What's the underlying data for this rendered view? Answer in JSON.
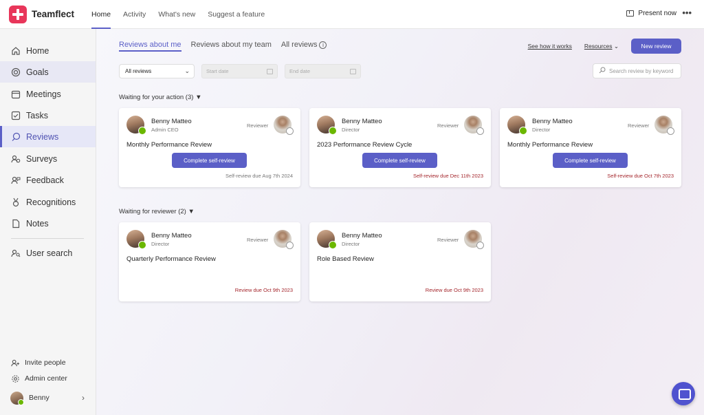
{
  "app": {
    "name": "Teamflect"
  },
  "topnav": {
    "items": [
      "Home",
      "Activity",
      "What's new",
      "Suggest a feature"
    ],
    "active": "Home"
  },
  "top_actions": {
    "present_label": "Present now",
    "more_label": "•••"
  },
  "sidebar": {
    "items": [
      {
        "label": "Home",
        "icon": "home-icon"
      },
      {
        "label": "Goals",
        "icon": "target-icon"
      },
      {
        "label": "Meetings",
        "icon": "calendar-icon"
      },
      {
        "label": "Tasks",
        "icon": "checkbox-icon"
      },
      {
        "label": "Reviews",
        "icon": "review-icon"
      },
      {
        "label": "Surveys",
        "icon": "survey-icon"
      },
      {
        "label": "Feedback",
        "icon": "feedback-icon"
      },
      {
        "label": "Recognitions",
        "icon": "medal-icon"
      },
      {
        "label": "Notes",
        "icon": "note-icon"
      },
      {
        "label": "User search",
        "icon": "user-search-icon"
      }
    ],
    "active": "Reviews",
    "bottom": {
      "invite": "Invite people",
      "admin": "Admin center",
      "user": "Benny"
    }
  },
  "tabs": [
    "Reviews about me",
    "Reviews about my team",
    "All reviews"
  ],
  "active_tab": "Reviews about me",
  "header_links": {
    "how": "See how it works",
    "resources": "Resources",
    "new_review": "New review"
  },
  "filters": {
    "select_value": "All reviews",
    "start_placeholder": "Start date",
    "end_placeholder": "End date",
    "search_placeholder": "Search review by keyword"
  },
  "sections": [
    {
      "title": "Waiting for your action (3)",
      "cards": [
        {
          "name": "Benny Matteo",
          "role": "Admin CEO",
          "reviewer_label": "Reviewer",
          "title": "Monthly Performance Review",
          "button": "Complete self-review",
          "due": "Self-review due Aug 7th 2024",
          "overdue": false
        },
        {
          "name": "Benny Matteo",
          "role": "Director",
          "reviewer_label": "Reviewer",
          "title": "2023 Performance Review Cycle",
          "button": "Complete self-review",
          "due": "Self-review due Dec 11th 2023",
          "overdue": true
        },
        {
          "name": "Benny Matteo",
          "role": "Director",
          "reviewer_label": "Reviewer",
          "title": "Monthly Performance Review",
          "button": "Complete self-review",
          "due": "Self-review due Oct 7th 2023",
          "overdue": true
        }
      ]
    },
    {
      "title": "Waiting for reviewer (2)",
      "cards": [
        {
          "name": "Benny Matteo",
          "role": "Director",
          "reviewer_label": "Reviewer",
          "title": "Quarterly Performance Review",
          "due": "Review due Oct 9th 2023",
          "overdue": true
        },
        {
          "name": "Benny Matteo",
          "role": "Director",
          "reviewer_label": "Reviewer",
          "title": "Role Based Review",
          "due": "Review due Oct 9th 2023",
          "overdue": true
        }
      ]
    }
  ],
  "colors": {
    "accent": "#5b5fc7",
    "overdue": "#a4262c",
    "online": "#6bb700",
    "brand": "#e8365a"
  }
}
